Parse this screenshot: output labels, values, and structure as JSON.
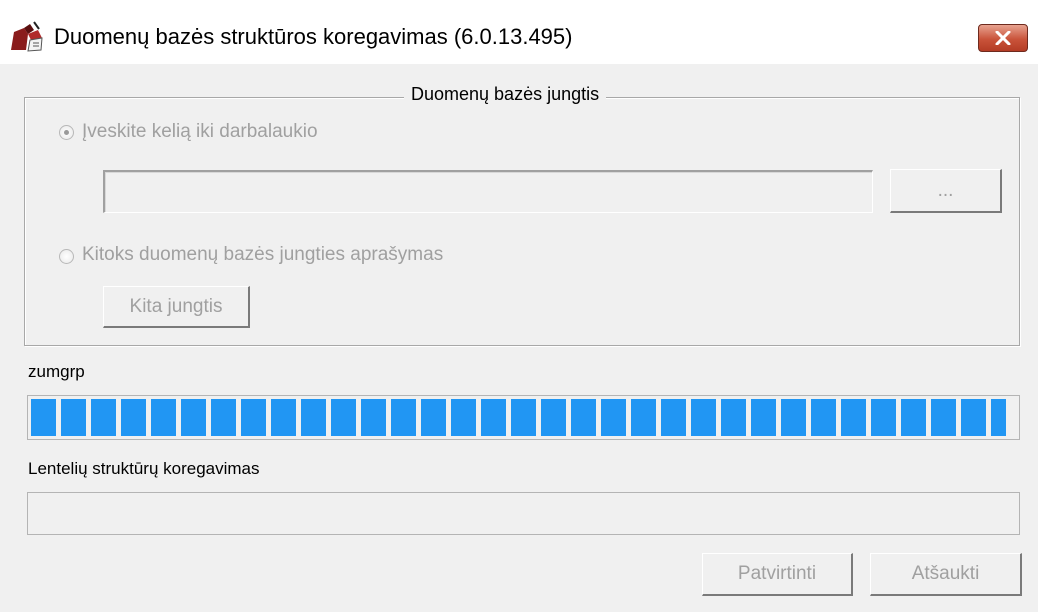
{
  "window": {
    "title": "Duomenų bazės struktūros koregavimas (6.0.13.495)",
    "close_icon": "close-icon",
    "app_icon": "app-icon"
  },
  "group": {
    "title": "Duomenų bazės jungtis",
    "option_path_label": "Įveskite kelią iki darbalaukio",
    "path_value": "",
    "browse_label": "...",
    "option_other_label": "Kitoks duomenų bazės jungties aprašymas",
    "other_connection_label": "Kita jungtis"
  },
  "progress": {
    "label": "zumgrp",
    "value": 0.99,
    "color": "#2196f3"
  },
  "progress2": {
    "label": "Lentelių struktūrų koregavimas",
    "value": 0
  },
  "buttons": {
    "confirm_label": "Patvirtinti",
    "cancel_label": "Atšaukti"
  }
}
